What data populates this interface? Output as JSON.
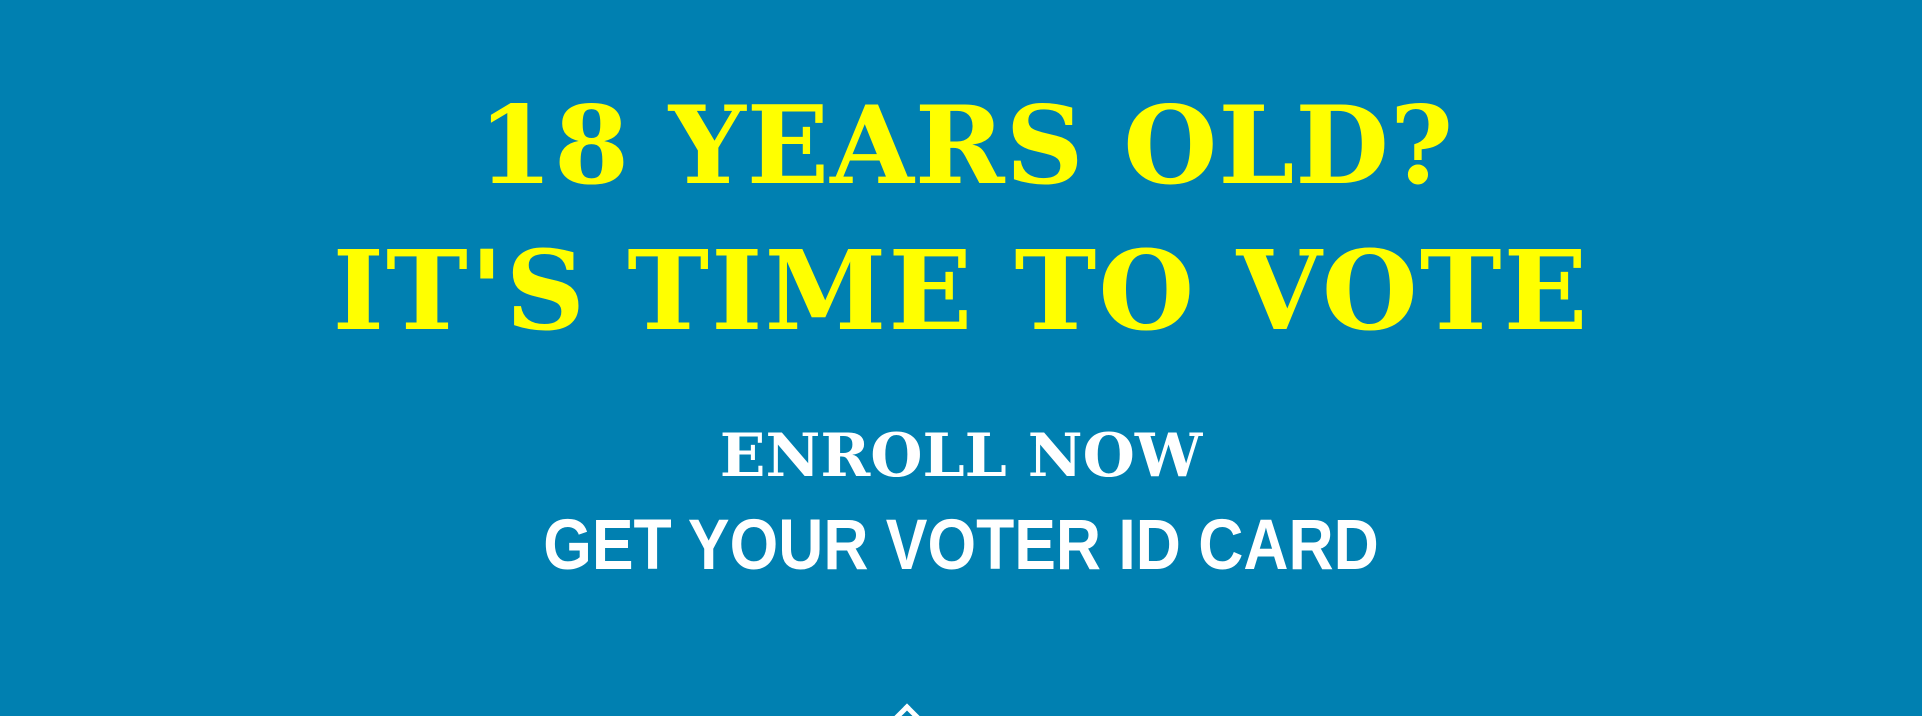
{
  "banner": {
    "headline_line1": "18 YEARS OLD?",
    "headline_line2": "IT'S TIME TO VOTE",
    "subheading": "ENROLL NOW",
    "tagline": "GET YOUR VOTER ID CARD"
  },
  "colors": {
    "background": "#0080b1",
    "headline": "#ffff00",
    "text": "#ffffff"
  },
  "icons": {
    "partial_icon": "arrow-up-icon"
  }
}
